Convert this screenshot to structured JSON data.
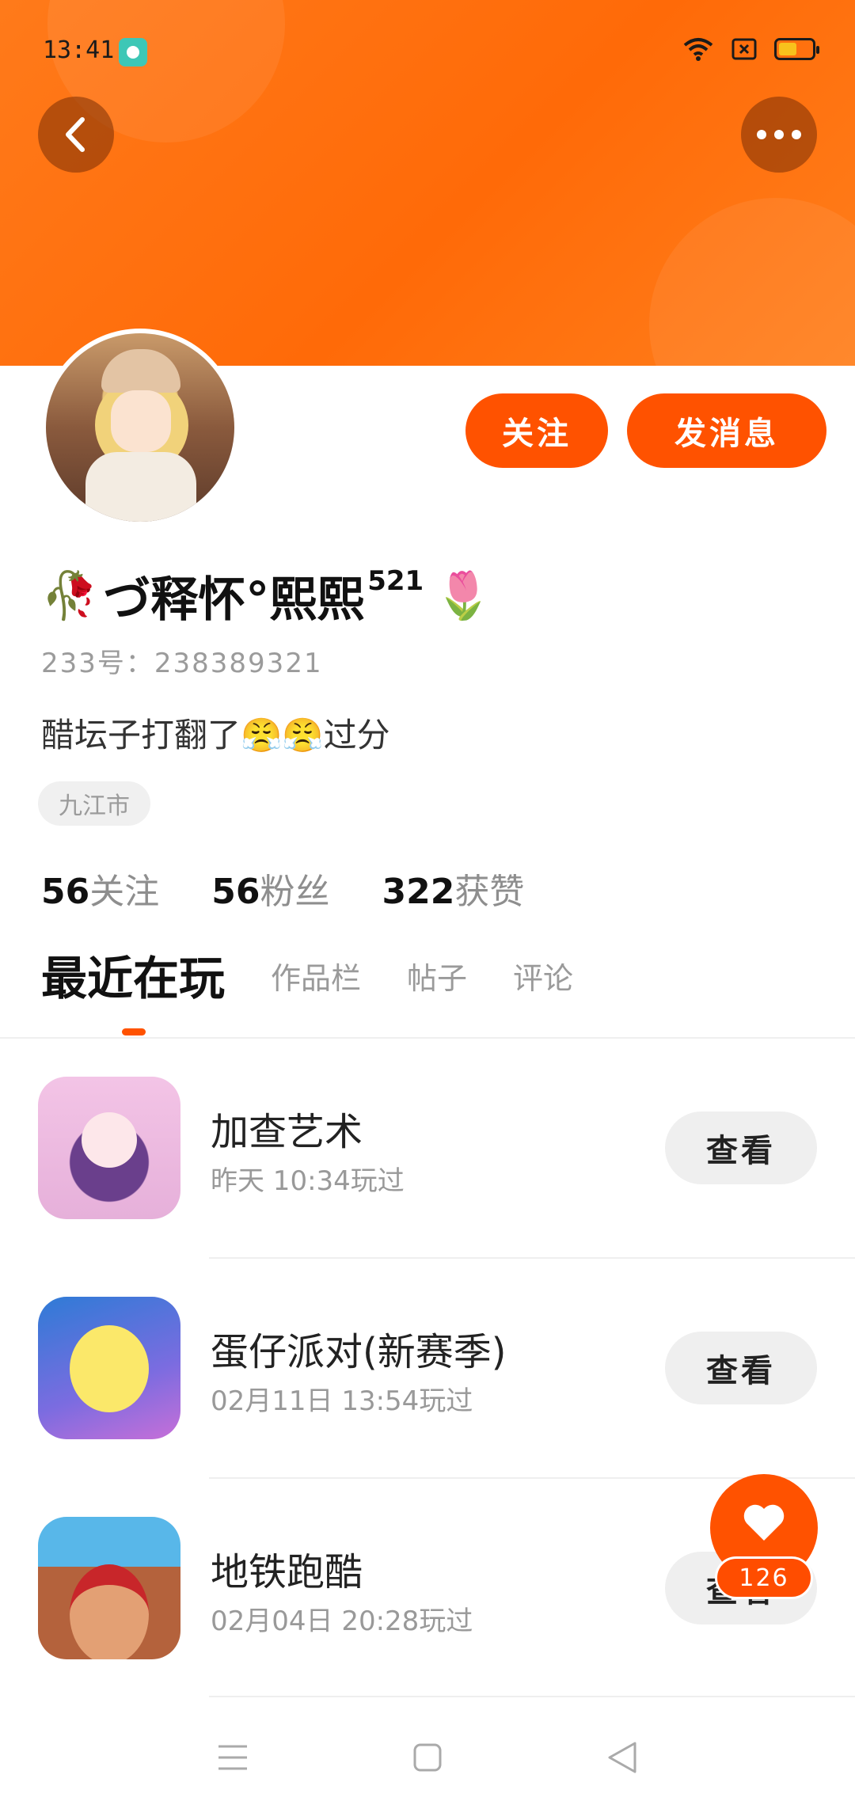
{
  "status_bar": {
    "time": "13:41"
  },
  "profile": {
    "nickname": "づ释怀°熙熙",
    "nickname_sup": "521",
    "uid": "233号：238389321",
    "bio": "醋坛子打翻了😤😤过分",
    "location": "九江市",
    "stats": [
      {
        "value": "56",
        "label": "关注"
      },
      {
        "value": "56",
        "label": "粉丝"
      },
      {
        "value": "322",
        "label": "获赞"
      }
    ]
  },
  "actions": {
    "follow_label": "关注",
    "message_label": "发消息"
  },
  "tabs": [
    {
      "label": "最近在玩",
      "active": true
    },
    {
      "label": "作品栏",
      "active": false
    },
    {
      "label": "帖子",
      "active": false
    },
    {
      "label": "评论",
      "active": false
    }
  ],
  "games": [
    {
      "title": "加查艺术",
      "meta": "昨天 10:34玩过",
      "button": "查看"
    },
    {
      "title": "蛋仔派对(新赛季)",
      "meta": "02月11日 13:54玩过",
      "button": "查看"
    },
    {
      "title": "地铁跑酷",
      "meta": "02月04日 20:28玩过",
      "button": "查看"
    }
  ],
  "like": {
    "count": "126"
  },
  "colors": {
    "accent": "#ff5200",
    "banner": "#ff7415"
  }
}
